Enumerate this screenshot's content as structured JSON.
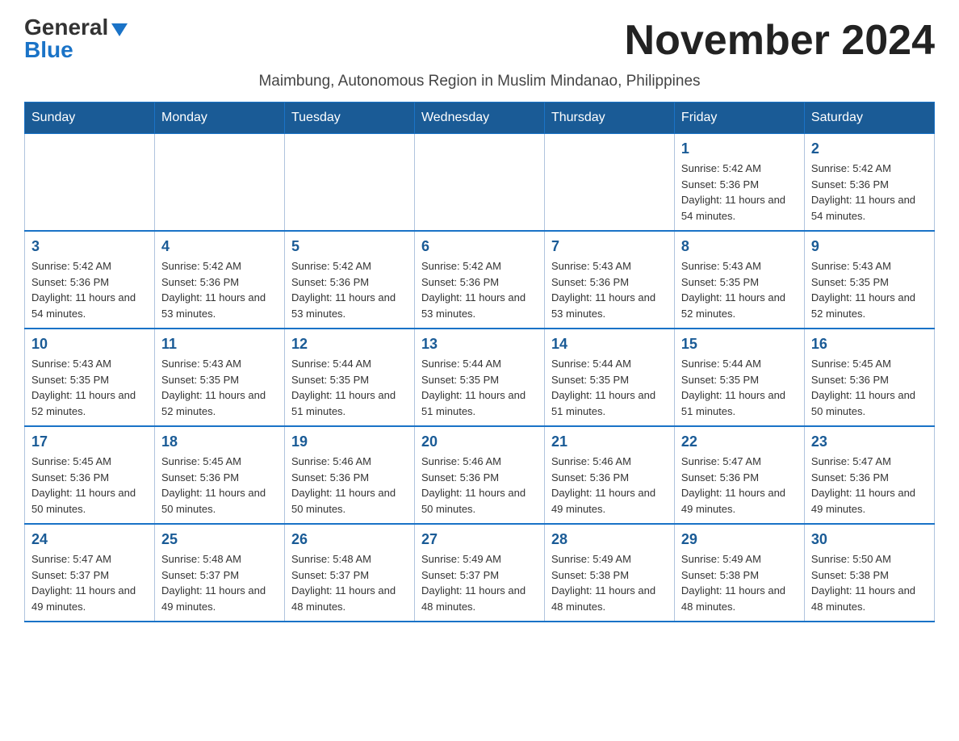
{
  "header": {
    "logo_general": "General",
    "logo_blue": "Blue",
    "month_title": "November 2024",
    "subtitle": "Maimbung, Autonomous Region in Muslim Mindanao, Philippines"
  },
  "days_of_week": [
    "Sunday",
    "Monday",
    "Tuesday",
    "Wednesday",
    "Thursday",
    "Friday",
    "Saturday"
  ],
  "weeks": [
    [
      {
        "day": "",
        "info": ""
      },
      {
        "day": "",
        "info": ""
      },
      {
        "day": "",
        "info": ""
      },
      {
        "day": "",
        "info": ""
      },
      {
        "day": "",
        "info": ""
      },
      {
        "day": "1",
        "info": "Sunrise: 5:42 AM\nSunset: 5:36 PM\nDaylight: 11 hours and 54 minutes."
      },
      {
        "day": "2",
        "info": "Sunrise: 5:42 AM\nSunset: 5:36 PM\nDaylight: 11 hours and 54 minutes."
      }
    ],
    [
      {
        "day": "3",
        "info": "Sunrise: 5:42 AM\nSunset: 5:36 PM\nDaylight: 11 hours and 54 minutes."
      },
      {
        "day": "4",
        "info": "Sunrise: 5:42 AM\nSunset: 5:36 PM\nDaylight: 11 hours and 53 minutes."
      },
      {
        "day": "5",
        "info": "Sunrise: 5:42 AM\nSunset: 5:36 PM\nDaylight: 11 hours and 53 minutes."
      },
      {
        "day": "6",
        "info": "Sunrise: 5:42 AM\nSunset: 5:36 PM\nDaylight: 11 hours and 53 minutes."
      },
      {
        "day": "7",
        "info": "Sunrise: 5:43 AM\nSunset: 5:36 PM\nDaylight: 11 hours and 53 minutes."
      },
      {
        "day": "8",
        "info": "Sunrise: 5:43 AM\nSunset: 5:35 PM\nDaylight: 11 hours and 52 minutes."
      },
      {
        "day": "9",
        "info": "Sunrise: 5:43 AM\nSunset: 5:35 PM\nDaylight: 11 hours and 52 minutes."
      }
    ],
    [
      {
        "day": "10",
        "info": "Sunrise: 5:43 AM\nSunset: 5:35 PM\nDaylight: 11 hours and 52 minutes."
      },
      {
        "day": "11",
        "info": "Sunrise: 5:43 AM\nSunset: 5:35 PM\nDaylight: 11 hours and 52 minutes."
      },
      {
        "day": "12",
        "info": "Sunrise: 5:44 AM\nSunset: 5:35 PM\nDaylight: 11 hours and 51 minutes."
      },
      {
        "day": "13",
        "info": "Sunrise: 5:44 AM\nSunset: 5:35 PM\nDaylight: 11 hours and 51 minutes."
      },
      {
        "day": "14",
        "info": "Sunrise: 5:44 AM\nSunset: 5:35 PM\nDaylight: 11 hours and 51 minutes."
      },
      {
        "day": "15",
        "info": "Sunrise: 5:44 AM\nSunset: 5:35 PM\nDaylight: 11 hours and 51 minutes."
      },
      {
        "day": "16",
        "info": "Sunrise: 5:45 AM\nSunset: 5:36 PM\nDaylight: 11 hours and 50 minutes."
      }
    ],
    [
      {
        "day": "17",
        "info": "Sunrise: 5:45 AM\nSunset: 5:36 PM\nDaylight: 11 hours and 50 minutes."
      },
      {
        "day": "18",
        "info": "Sunrise: 5:45 AM\nSunset: 5:36 PM\nDaylight: 11 hours and 50 minutes."
      },
      {
        "day": "19",
        "info": "Sunrise: 5:46 AM\nSunset: 5:36 PM\nDaylight: 11 hours and 50 minutes."
      },
      {
        "day": "20",
        "info": "Sunrise: 5:46 AM\nSunset: 5:36 PM\nDaylight: 11 hours and 50 minutes."
      },
      {
        "day": "21",
        "info": "Sunrise: 5:46 AM\nSunset: 5:36 PM\nDaylight: 11 hours and 49 minutes."
      },
      {
        "day": "22",
        "info": "Sunrise: 5:47 AM\nSunset: 5:36 PM\nDaylight: 11 hours and 49 minutes."
      },
      {
        "day": "23",
        "info": "Sunrise: 5:47 AM\nSunset: 5:36 PM\nDaylight: 11 hours and 49 minutes."
      }
    ],
    [
      {
        "day": "24",
        "info": "Sunrise: 5:47 AM\nSunset: 5:37 PM\nDaylight: 11 hours and 49 minutes."
      },
      {
        "day": "25",
        "info": "Sunrise: 5:48 AM\nSunset: 5:37 PM\nDaylight: 11 hours and 49 minutes."
      },
      {
        "day": "26",
        "info": "Sunrise: 5:48 AM\nSunset: 5:37 PM\nDaylight: 11 hours and 48 minutes."
      },
      {
        "day": "27",
        "info": "Sunrise: 5:49 AM\nSunset: 5:37 PM\nDaylight: 11 hours and 48 minutes."
      },
      {
        "day": "28",
        "info": "Sunrise: 5:49 AM\nSunset: 5:38 PM\nDaylight: 11 hours and 48 minutes."
      },
      {
        "day": "29",
        "info": "Sunrise: 5:49 AM\nSunset: 5:38 PM\nDaylight: 11 hours and 48 minutes."
      },
      {
        "day": "30",
        "info": "Sunrise: 5:50 AM\nSunset: 5:38 PM\nDaylight: 11 hours and 48 minutes."
      }
    ]
  ]
}
